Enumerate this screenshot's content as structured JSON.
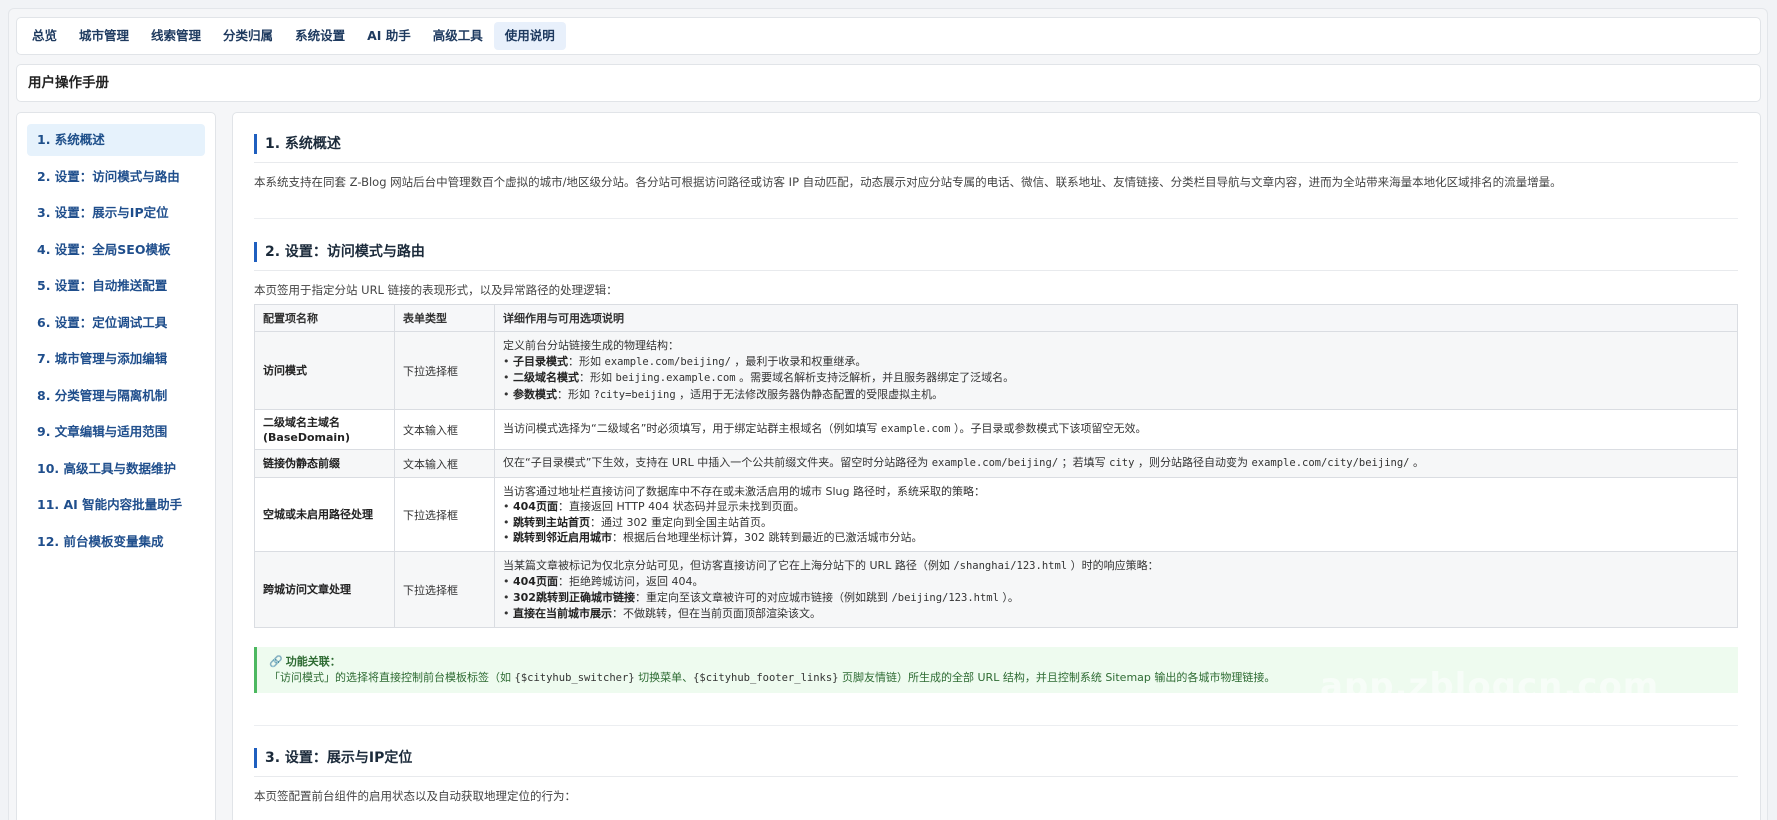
{
  "nav": {
    "tabs": [
      {
        "label": "总览"
      },
      {
        "label": "城市管理"
      },
      {
        "label": "线索管理"
      },
      {
        "label": "分类归属"
      },
      {
        "label": "系统设置"
      },
      {
        "label": "AI 助手"
      },
      {
        "label": "高级工具"
      },
      {
        "label": "使用说明"
      }
    ],
    "active": "使用说明"
  },
  "page_title": "用户操作手册",
  "sidebar": {
    "items": [
      {
        "label": "1. 系统概述"
      },
      {
        "label": "2. 设置：访问模式与路由"
      },
      {
        "label": "3. 设置：展示与IP定位"
      },
      {
        "label": "4. 设置：全局SEO模板"
      },
      {
        "label": "5. 设置：自动推送配置"
      },
      {
        "label": "6. 设置：定位调试工具"
      },
      {
        "label": "7. 城市管理与添加编辑"
      },
      {
        "label": "8. 分类管理与隔离机制"
      },
      {
        "label": "9. 文章编辑与适用范围"
      },
      {
        "label": "10. 高级工具与数据维护"
      },
      {
        "label": "11. AI 智能内容批量助手"
      },
      {
        "label": "12. 前台模板变量集成"
      }
    ]
  },
  "sections": {
    "s1": {
      "title": "1. 系统概述",
      "desc": "本系统支持在同套 Z-Blog 网站后台中管理数百个虚拟的城市/地区级分站。各分站可根据访问路径或访客 IP 自动匹配，动态展示对应分站专属的电话、微信、联系地址、友情链接、分类栏目导航与文章内容，进而为全站带来海量本地化区域排名的流量增量。"
    },
    "s2": {
      "title": "2. 设置：访问模式与路由",
      "desc": "本页签用于指定分站 URL 链接的表现形式，以及异常路径的处理逻辑：",
      "table": {
        "headers": [
          "配置项名称",
          "表单类型",
          "详细作用与可用选项说明"
        ],
        "rows": [
          {
            "name": "访问模式",
            "type": "下拉选择框",
            "intro": "定义前台分站链接生成的物理结构：",
            "b1_bold": "子目录模式",
            "b1_a": "：形如 ",
            "b1_code": "example.com/beijing/",
            "b1_b": " ，最利于收录和权重继承。",
            "b2_bold": "二级域名模式",
            "b2_a": "：形如 ",
            "b2_code": "beijing.example.com",
            "b2_b": " 。需要域名解析支持泛解析，并且服务器绑定了泛域名。",
            "b3_bold": "参数模式",
            "b3_a": "：形如 ",
            "b3_code": "?city=beijing",
            "b3_b": " ，适用于无法修改服务器伪静态配置的受限虚拟主机。"
          },
          {
            "name_l1": "二级域名主域名",
            "name_l2": "(BaseDomain)",
            "type": "文本输入框",
            "a": "当访问模式选择为“二级域名”时必须填写，用于绑定站群主根域名（例如填写 ",
            "code": "example.com",
            "b": " ）。子目录或参数模式下该项留空无效。"
          },
          {
            "name": "链接伪静态前缀",
            "type": "文本输入框",
            "a": "仅在“子目录模式”下生效，支持在 URL 中插入一个公共前缀文件夹。留空时分站路径为 ",
            "code1": "example.com/beijing/",
            "b": " ；若填写 ",
            "code2": "city",
            "c": " ，则分站路径自动变为 ",
            "code3": "example.com/city/beijing/",
            "d": " 。"
          },
          {
            "name": "空城或未启用路径处理",
            "type": "下拉选择框",
            "intro": "当访客通过地址栏直接访问了数据库中不存在或未激活启用的城市 Slug 路径时，系统采取的策略：",
            "b1_bold": "404页面",
            "b1_text": "：直接返回 HTTP 404 状态码并显示未找到页面。",
            "b2_bold": "跳转到主站首页",
            "b2_text": "：通过 302 重定向到全国主站首页。",
            "b3_bold": "跳转到邻近启用城市",
            "b3_text": "：根据后台地理坐标计算，302 跳转到最近的已激活城市分站。"
          },
          {
            "name": "跨城访问文章处理",
            "type": "下拉选择框",
            "intro_a": "当某篇文章被标记为仅北京分站可见，但访客直接访问了它在上海分站下的 URL 路径（例如 ",
            "intro_code": "/shanghai/123.html",
            "intro_b": " ）时的响应策略：",
            "b1_bold": "404页面",
            "b1_text": "：拒绝跨城访问，返回 404。",
            "b2_bold": "302跳转到正确城市链接",
            "b2_a": "：重定向至该文章被许可的对应城市链接（例如跳到 ",
            "b2_code": "/beijing/123.html",
            "b2_b": " ）。",
            "b3_bold": "直接在当前城市展示",
            "b3_text": "：不做跳转，但在当前页面顶部渲染该文。"
          }
        ]
      },
      "callout": {
        "head": "功能关联：",
        "a": "「访问模式」的选择将直接控制前台模板标签（如 ",
        "code1": "{$cityhub_switcher}",
        "b": " 切换菜单、",
        "code2": "{$cityhub_footer_links}",
        "c": " 页脚友情链）所生成的全部 URL 结构，并且控制系统 Sitemap 输出的各城市物理链接。"
      }
    },
    "s3": {
      "title": "3. 设置：展示与IP定位",
      "desc": "本页签配置前台组件的启用状态以及自动获取地理定位的行为："
    }
  },
  "watermark": "app.zblogcn.com"
}
